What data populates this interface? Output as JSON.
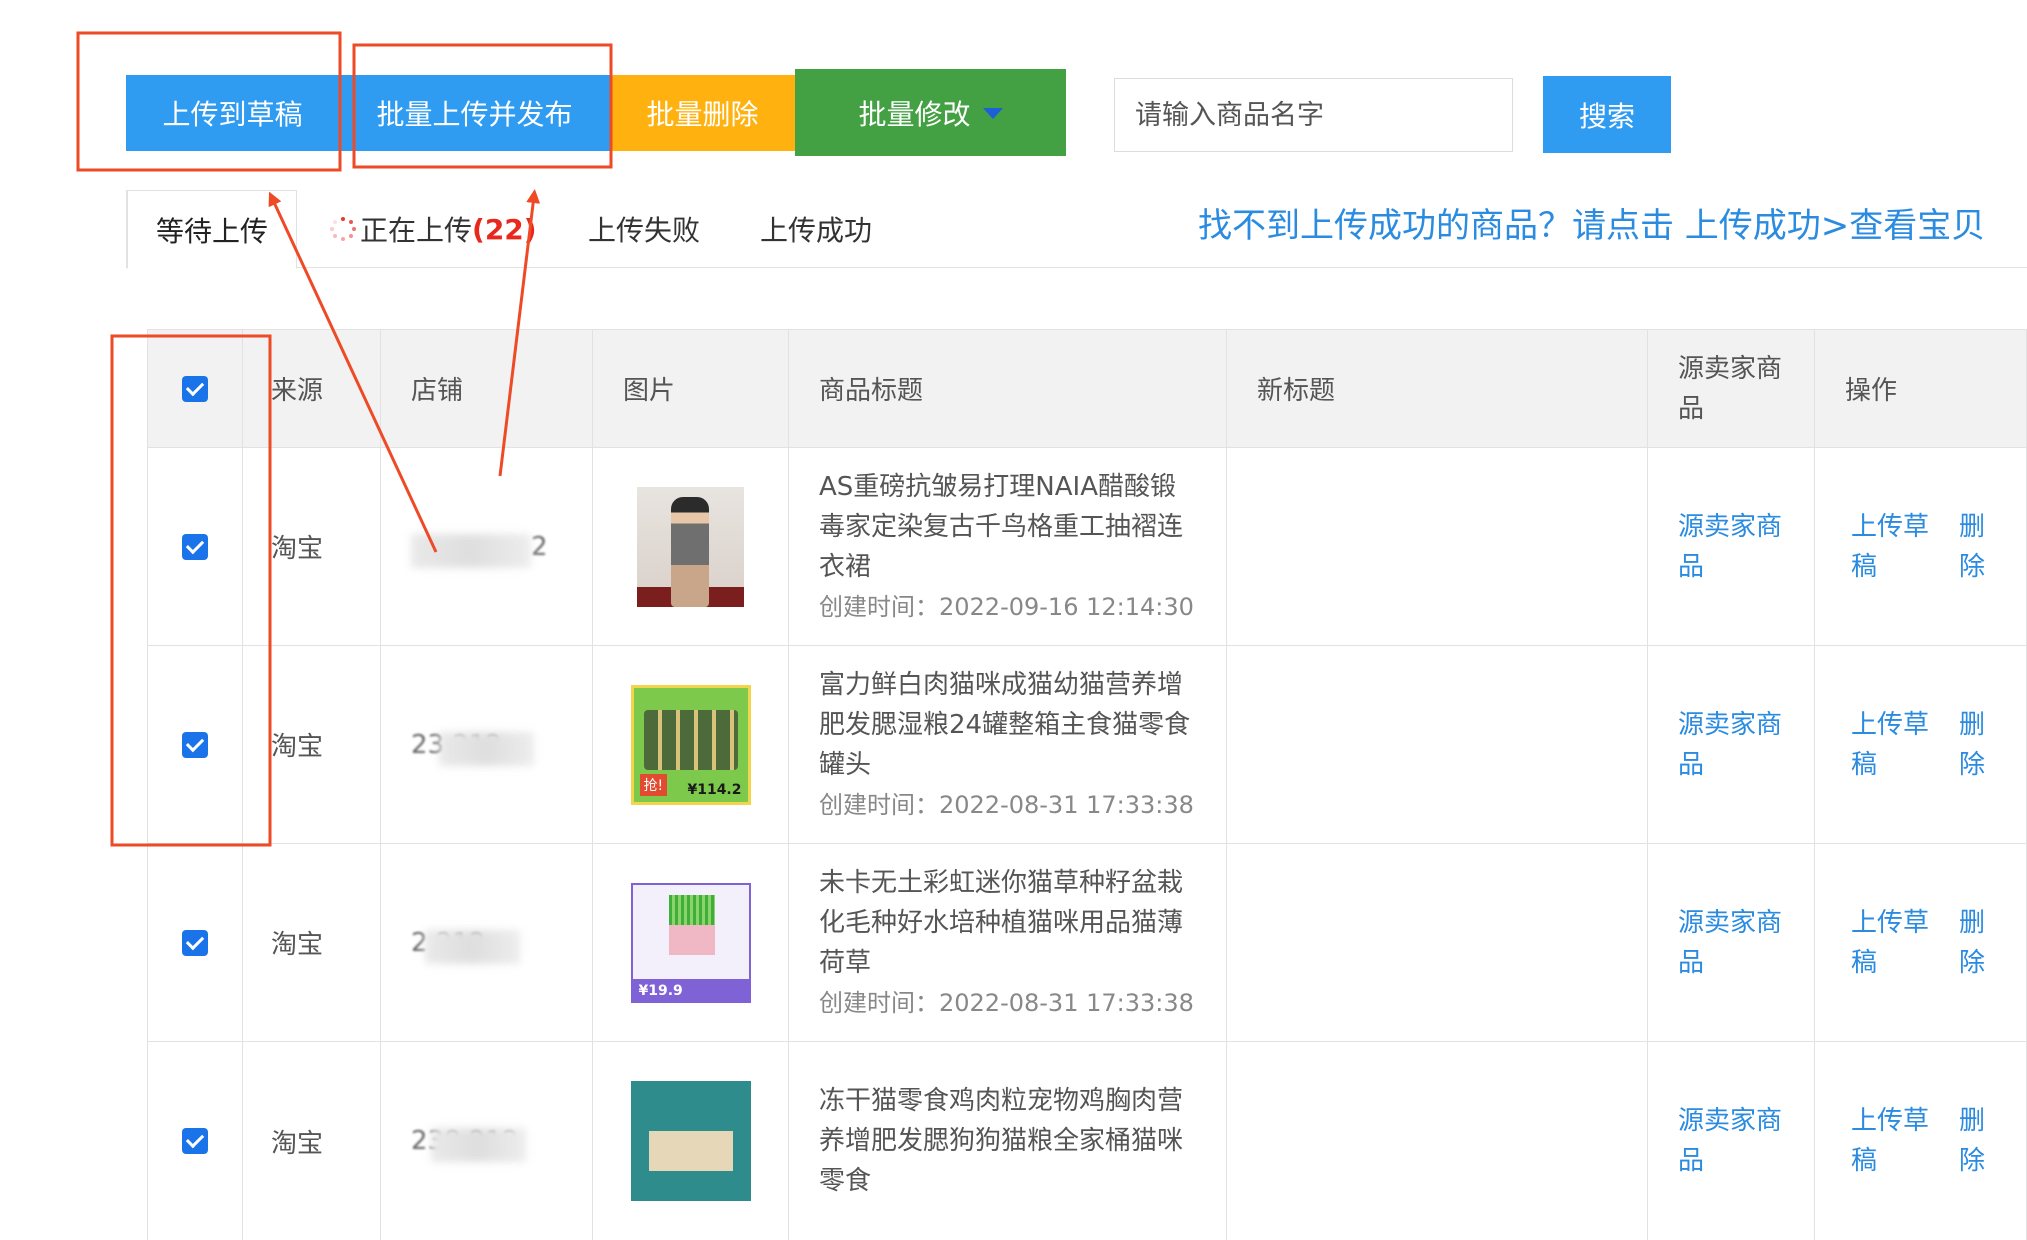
{
  "toolbar": {
    "upload_draft": "上传到草稿",
    "batch_upload_publish": "批量上传并发布",
    "batch_delete": "批量删除",
    "batch_modify": "批量修改",
    "search_placeholder": "请输入商品名字",
    "search_button": "搜索"
  },
  "colors": {
    "primary_blue": "#2f9cf2",
    "delete_orange": "#ffb20f",
    "modify_green": "#43a043",
    "link_blue": "#2a8be0",
    "count_red": "#e8281c",
    "annotation_red": "#ee4a26"
  },
  "tabs": [
    {
      "label": "等待上传"
    },
    {
      "label": "正在上传",
      "count": "(22)"
    },
    {
      "label": "上传失败"
    },
    {
      "label": "上传成功"
    }
  ],
  "help_text": "找不到上传成功的商品？请点击 上传成功>查看宝贝",
  "table": {
    "headers": {
      "source": "来源",
      "shop": "店铺",
      "image": "图片",
      "title": "商品标题",
      "new_title": "新标题",
      "source_seller": "源卖家商品",
      "actions": "操作"
    },
    "rows": [
      {
        "checked": true,
        "source": "淘宝",
        "shop": "2",
        "image_icon": "product-photo-dress",
        "title": "AS重磅抗皱易打理NAIA醋酸锻毒家定染复古千鸟格重工抽褶连衣裙",
        "created": "创建时间：2022-09-16 12:14:30",
        "new_title": "",
        "seller_link": "源卖家商品",
        "action_draft": "上传草稿",
        "action_delete": "删除"
      },
      {
        "checked": true,
        "source": "淘宝",
        "shop": "23 212",
        "image_icon": "product-photo-cat-food",
        "title": "富力鲜白肉猫咪成猫幼猫营养增肥发腮湿粮24罐整箱主食猫零食罐头",
        "created": "创建时间：2022-08-31 17:33:38",
        "new_title": "",
        "seller_link": "源卖家商品",
        "action_draft": "上传草稿",
        "action_delete": "删除"
      },
      {
        "checked": true,
        "source": "淘宝",
        "shop": "2 212",
        "image_icon": "product-photo-cat-grass",
        "title": "未卡无土彩虹迷你猫草种籽盆栽化毛种好水培种植猫咪用品猫薄荷草",
        "created": "创建时间：2022-08-31 17:33:38",
        "new_title": "",
        "seller_link": "源卖家商品",
        "action_draft": "上传草稿",
        "action_delete": "删除"
      },
      {
        "checked": true,
        "source": "淘宝",
        "shop": "238 212",
        "image_icon": "product-photo-chicken-snack",
        "title": "冻干猫零食鸡肉粒宠物鸡胸肉营养增肥发腮狗狗猫粮全家桶猫咪零食",
        "created": "",
        "new_title": "",
        "seller_link": "源卖家商品",
        "action_draft": "上传草稿",
        "action_delete": "删除"
      }
    ]
  }
}
